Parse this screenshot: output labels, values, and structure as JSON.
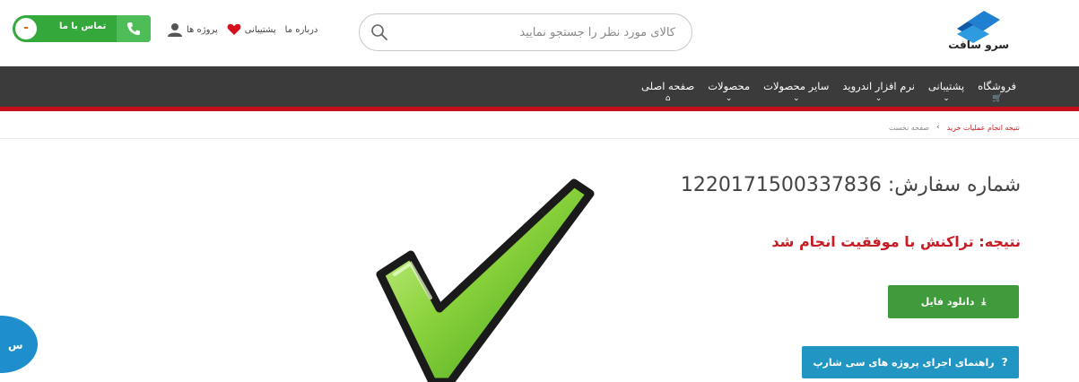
{
  "header": {
    "logo_text": "سرو سافت",
    "search": {
      "placeholder": "کالای مورد نظر را جستجو نمایید"
    },
    "top_links": [
      {
        "label": "پروژه ها",
        "icon": "user-icon"
      },
      {
        "label": "پشتیبانی",
        "icon": "heart-icon"
      },
      {
        "label": "درباره ما"
      }
    ],
    "contact": {
      "label": "تماس با ما",
      "toggle": "-"
    }
  },
  "nav": {
    "items": [
      {
        "label": "صفحه اصلی",
        "sub": "⌂"
      },
      {
        "label": "محصولات",
        "sub": "⌄"
      },
      {
        "label": "سایر محصولات",
        "sub": "⌄"
      },
      {
        "label": "نرم افزار اندروید",
        "sub": "⌄"
      },
      {
        "label": "پشتیبانی",
        "sub": "⌄"
      },
      {
        "label": "فروشگاه",
        "sub": "🛒"
      }
    ]
  },
  "breadcrumb": {
    "home": "صفحه نخست",
    "separator": "›",
    "current": "نتیجه انجام عملیات خرید"
  },
  "main": {
    "order_label": "شماره سفارش:",
    "order_number": "1220171500337836",
    "result": "نتیجه: تراکنش با موفقیت انجام شد",
    "download_label": "دانلود فایل",
    "guide_label": "راهنمای اجرای پروژه های سی شارپ",
    "chat_label": "س"
  },
  "colors": {
    "nav_bg": "#3b3b3b",
    "accent_red": "#c50f1b",
    "success_green": "#3f9b3c",
    "info_blue": "#2196c2"
  }
}
